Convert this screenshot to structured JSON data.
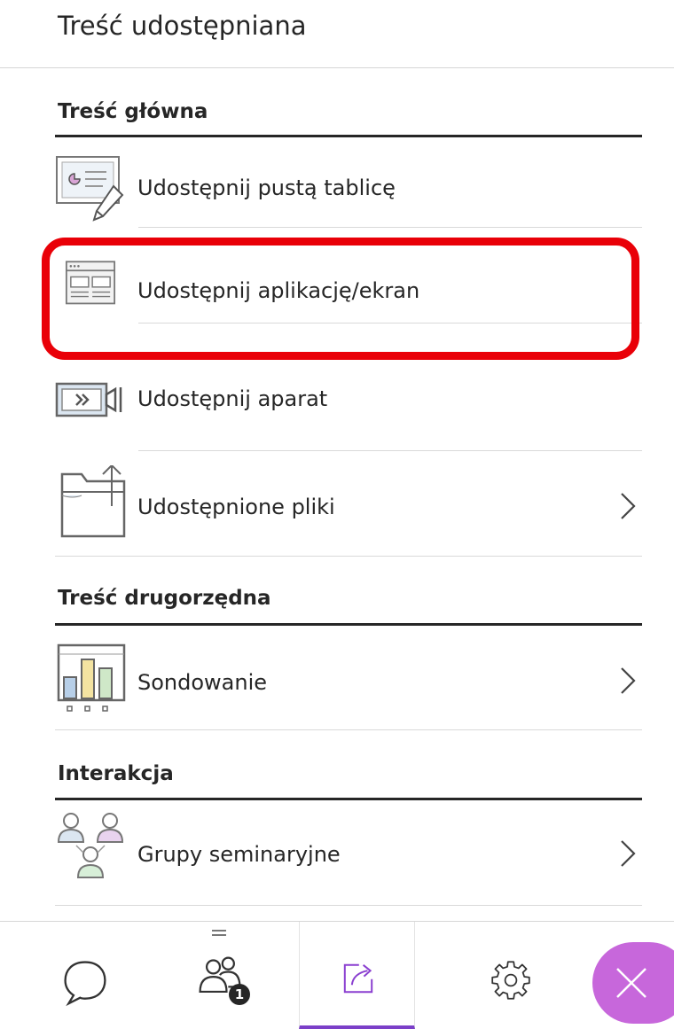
{
  "header": {
    "title": "Treść udostępniana"
  },
  "sections": {
    "primary": {
      "title": "Treść główna",
      "items": [
        {
          "label": "Udostępnij pustą tablicę",
          "icon": "whiteboard-icon"
        },
        {
          "label": "Udostępnij aplikację/ekran",
          "icon": "application-window-icon"
        },
        {
          "label": "Udostępnij aparat",
          "icon": "camera-icon"
        },
        {
          "label": "Udostępnione pliki",
          "icon": "folder-icon",
          "has_submenu": true
        }
      ]
    },
    "secondary": {
      "title": "Treść drugorzędna",
      "items": [
        {
          "label": "Sondowanie",
          "icon": "poll-chart-icon",
          "has_submenu": true
        }
      ]
    },
    "interaction": {
      "title": "Interakcja",
      "items": [
        {
          "label": "Grupy seminaryjne",
          "icon": "breakout-groups-icon",
          "has_submenu": true
        }
      ]
    }
  },
  "footer": {
    "tabs": [
      {
        "name": "chat",
        "icon": "chat-bubble-icon"
      },
      {
        "name": "attendees",
        "icon": "attendees-icon",
        "badge": "1"
      },
      {
        "name": "share-content",
        "icon": "share-icon",
        "active": true
      },
      {
        "name": "settings",
        "icon": "gear-icon"
      },
      {
        "name": "close",
        "icon": "close-icon"
      }
    ]
  },
  "colors": {
    "highlight": "#e90008",
    "active_tab_accent": "#7b3fc8",
    "close_button": "#c767db",
    "text": "#262626"
  }
}
